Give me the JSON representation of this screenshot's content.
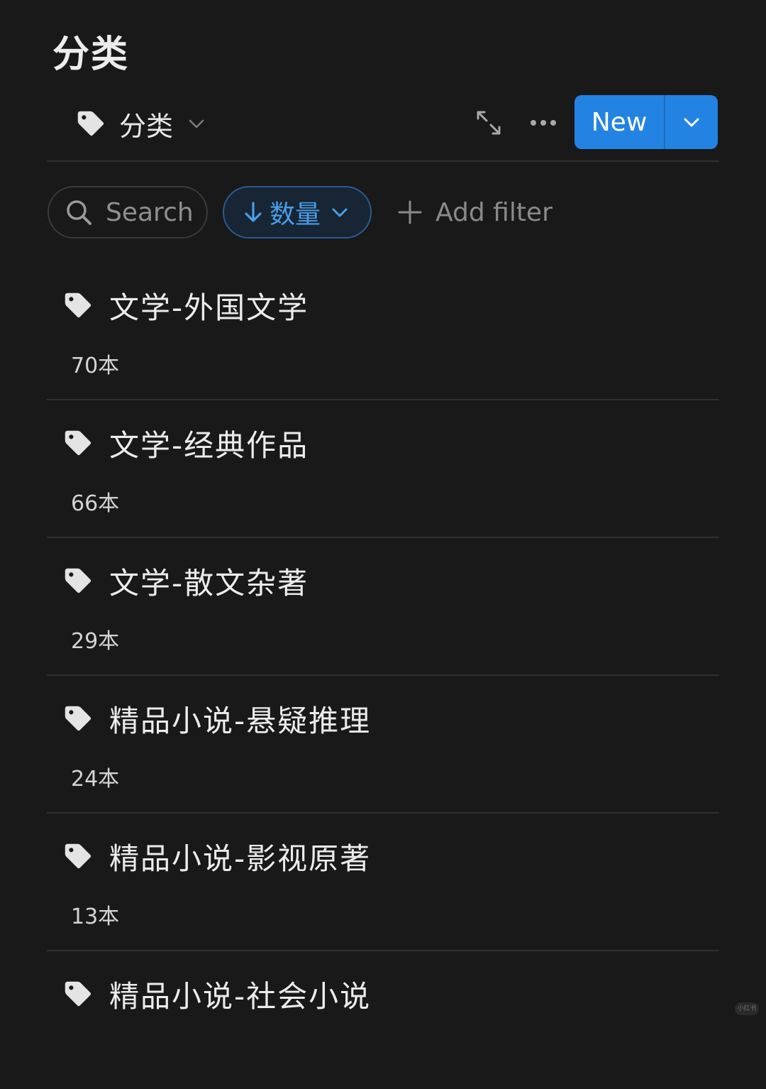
{
  "page": {
    "title": "分类"
  },
  "view": {
    "icon": "tag-icon",
    "label": "分类",
    "expand_icon": "expand-arrows-icon",
    "more_icon": "more-dots-icon",
    "new_label": "New",
    "new_dropdown_icon": "chevron-down-icon"
  },
  "toolbar": {
    "search_label": "Search",
    "sort_label": "数量",
    "sort_direction": "descending",
    "add_filter_label": "Add filter"
  },
  "items": [
    {
      "title": "文学-外国文学",
      "count": "70本"
    },
    {
      "title": "文学-经典作品",
      "count": "66本"
    },
    {
      "title": "文学-散文杂著",
      "count": "29本"
    },
    {
      "title": "精品小说-悬疑推理",
      "count": "24本"
    },
    {
      "title": "精品小说-影视原著",
      "count": "13本"
    },
    {
      "title": "精品小说-社会小说",
      "count": ""
    }
  ],
  "watermark": "小红书",
  "colors": {
    "background": "#191919",
    "accent": "#2383e2",
    "sort_text": "#4a9de8",
    "divider": "#2f2f2f"
  }
}
